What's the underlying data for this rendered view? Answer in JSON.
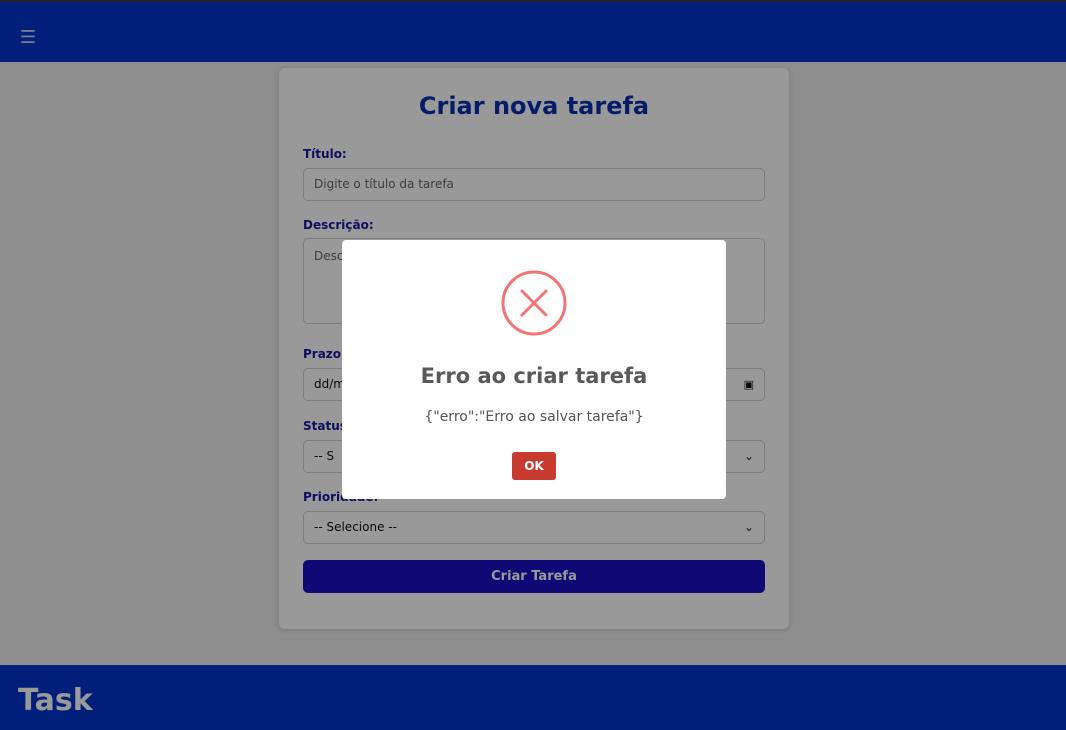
{
  "navbar": {
    "menu_icon": "☰",
    "menu_icon_name": "hamburger-menu-icon"
  },
  "form": {
    "title": "Criar nova tarefa",
    "titulo_label": "Título:",
    "titulo_placeholder": "Digite o título da tarefa",
    "descricao_label": "Descrição:",
    "descricao_placeholder": "Descrição",
    "prazo_label": "Prazo (",
    "prazo_value": "dd/m",
    "status_label": "Status",
    "status_value": "-- S",
    "prioridade_label": "Prioridade:",
    "prioridade_value": "-- Selecione --",
    "submit_label": "Criar Tarefa",
    "accent_color": "#1a10c4"
  },
  "footer": {
    "brand": "Task"
  },
  "modal": {
    "icon_name": "error-x-icon",
    "title": "Erro ao criar tarefa",
    "message": "{\"erro\":\"Erro ao salvar tarefa\"}",
    "ok_label": "OK",
    "icon_color": "#f27474",
    "button_color": "#c73a2f"
  }
}
